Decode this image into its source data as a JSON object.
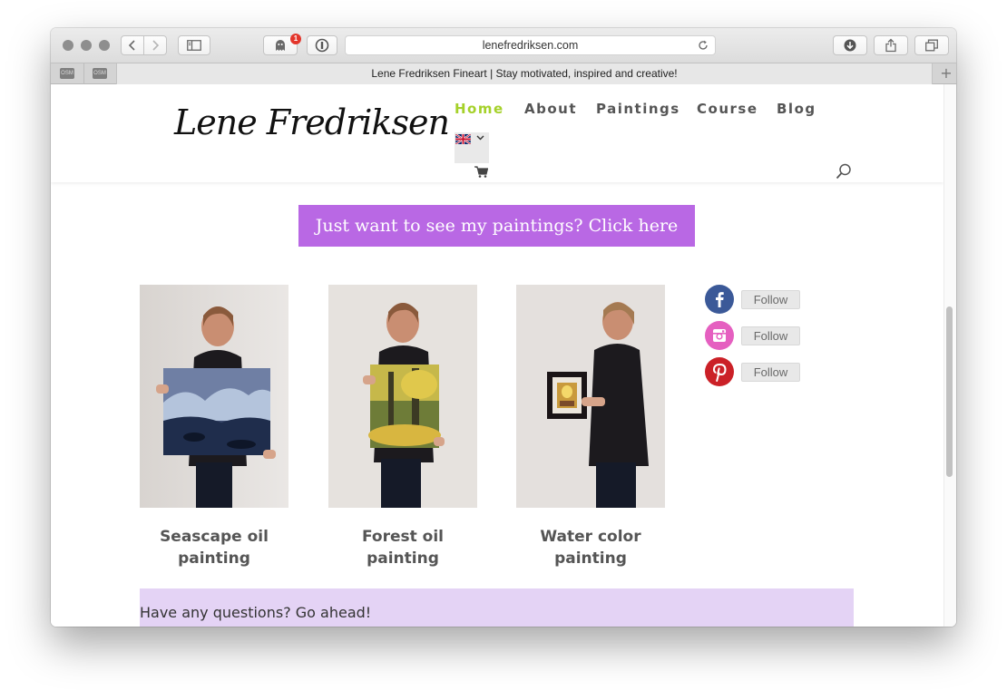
{
  "browser": {
    "url": "lenefredriksen.com",
    "tab_title": "Lene Fredriksen Fineart | Stay motivated, inspired and creative!",
    "notification_count": "1",
    "pinned_tabs": [
      "OSM",
      "OSM"
    ],
    "new_tab_symbol": "+"
  },
  "site": {
    "logo_text": "Lene Fredriksen",
    "nav": [
      {
        "label": "Home",
        "active": true
      },
      {
        "label": "About",
        "active": false
      },
      {
        "label": "Paintings",
        "active": false
      },
      {
        "label": "Course",
        "active": false
      },
      {
        "label": "Blog",
        "active": false
      }
    ],
    "language": "uk-flag-icon",
    "accent_color": "#a5d12a"
  },
  "cta": {
    "label": "Just want to see my paintings? Click here",
    "color": "#b968e4"
  },
  "gallery": [
    {
      "caption": "Seascape oil painting"
    },
    {
      "caption": "Forest oil painting"
    },
    {
      "caption": "Water color painting"
    }
  ],
  "social": [
    {
      "network": "facebook-icon",
      "label": "Follow",
      "color": "#3b5998"
    },
    {
      "network": "instagram-icon",
      "label": "Follow",
      "color": "#e55fc0"
    },
    {
      "network": "pinterest-icon",
      "label": "Follow",
      "color": "#cb2027"
    }
  ],
  "questions": {
    "text": "Have any questions? Go ahead!",
    "background": "#e4d3f5"
  }
}
